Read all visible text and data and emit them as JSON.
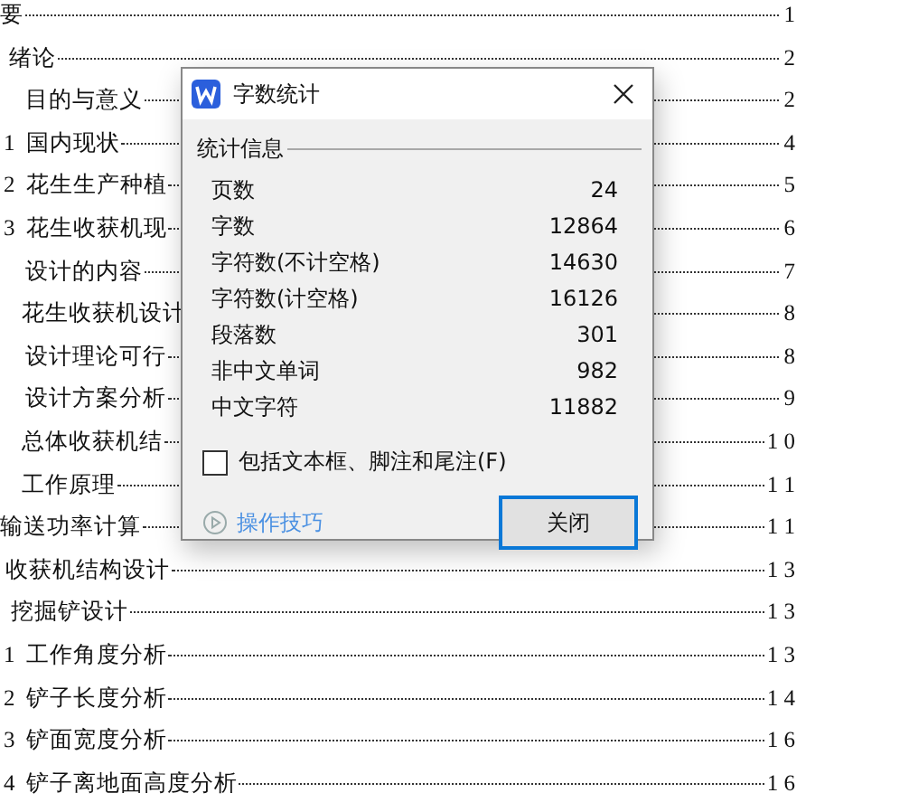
{
  "toc": [
    {
      "title": "要",
      "page": "1"
    },
    {
      "title": "绪论",
      "page": "2"
    },
    {
      "title": "目的与意义",
      "page": "2"
    },
    {
      "prefix": "1",
      "title": "国内现状",
      "page": "4"
    },
    {
      "prefix": "2",
      "title": "花生生产种植",
      "page": "5"
    },
    {
      "prefix": "3",
      "title": "花生收获机现",
      "page": "6"
    },
    {
      "title": "设计的内容",
      "page": "7"
    },
    {
      "title": "花生收获机设计",
      "page": "8"
    },
    {
      "title": "设计理论可行",
      "page": "8"
    },
    {
      "title": "设计方案分析",
      "page": "9"
    },
    {
      "title": "总体收获机结",
      "page": "1 0"
    },
    {
      "title": "工作原理",
      "page": "1 1"
    },
    {
      "title": "输送功率计算",
      "page": "1 1"
    },
    {
      "title": "收获机结构设计",
      "page": "1 3"
    },
    {
      "title": "挖掘铲设计",
      "page": "1 3"
    },
    {
      "prefix": "1",
      "title": "工作角度分析",
      "page": "1 3"
    },
    {
      "prefix": "2",
      "title": "铲子长度分析",
      "page": "1 4"
    },
    {
      "prefix": "3",
      "title": "铲面宽度分析",
      "page": "1 6"
    },
    {
      "prefix": "4",
      "title": "铲子离地面高度分析",
      "page": "1 6"
    }
  ],
  "dialog": {
    "title": "字数统计",
    "section": "统计信息",
    "stats": [
      {
        "label": "页数",
        "value": "24"
      },
      {
        "label": "字数",
        "value": "12864"
      },
      {
        "label": "字符数(不计空格)",
        "value": "14630"
      },
      {
        "label": "字符数(计空格)",
        "value": "16126"
      },
      {
        "label": "段落数",
        "value": "301"
      },
      {
        "label": "非中文单词",
        "value": "982"
      },
      {
        "label": "中文字符",
        "value": "11882"
      }
    ],
    "checkbox": {
      "label": "包括文本框、脚注和尾注(F)",
      "checked": false
    },
    "tips_link": "操作技巧",
    "close_button": "关闭"
  }
}
